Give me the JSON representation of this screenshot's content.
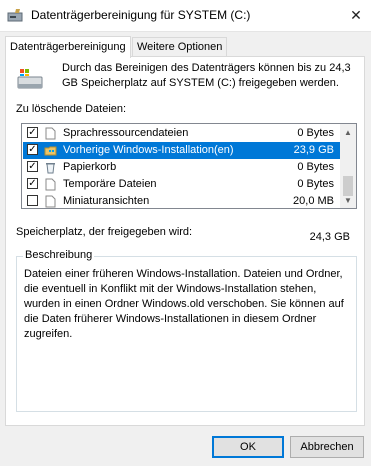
{
  "window": {
    "title": "Datenträgerbereinigung für SYSTEM (C:)",
    "close_glyph": "✕"
  },
  "tabs": [
    {
      "label": "Datenträgerbereinigung",
      "active": true
    },
    {
      "label": "Weitere Optionen",
      "active": false
    }
  ],
  "intro_text": "Durch das Bereinigen des Datenträgers können bis zu 24,3 GB Speicherplatz auf SYSTEM (C:) freigegeben werden.",
  "files_label": "Zu löschende Dateien:",
  "files": [
    {
      "name": "Sprachressourcendateien",
      "size": "0 Bytes",
      "checked": true,
      "icon": "file-icon",
      "selected": false
    },
    {
      "name": "Vorherige Windows-Installation(en)",
      "size": "23,9 GB",
      "checked": true,
      "icon": "windows-folder-icon",
      "selected": true
    },
    {
      "name": "Papierkorb",
      "size": "0 Bytes",
      "checked": true,
      "icon": "recycle-bin-icon",
      "selected": false
    },
    {
      "name": "Temporäre Dateien",
      "size": "0 Bytes",
      "checked": true,
      "icon": "file-icon",
      "selected": false
    },
    {
      "name": "Miniaturansichten",
      "size": "20,0 MB",
      "checked": false,
      "icon": "file-icon",
      "selected": false
    }
  ],
  "space": {
    "label": "Speicherplatz, der freigegeben wird:",
    "value": "24,3 GB"
  },
  "description": {
    "title": "Beschreibung",
    "text": "Dateien einer früheren Windows-Installation. Dateien und Ordner, die eventuell in Konflikt mit der Windows-Installation stehen, wurden in einen Ordner Windows.old verschoben. Sie können auf die Daten früherer Windows-Installationen in diesem Ordner zugreifen."
  },
  "buttons": {
    "ok": "OK",
    "cancel": "Abbrechen"
  },
  "colors": {
    "selection": "#0078d7",
    "accent": "#0078d7"
  }
}
